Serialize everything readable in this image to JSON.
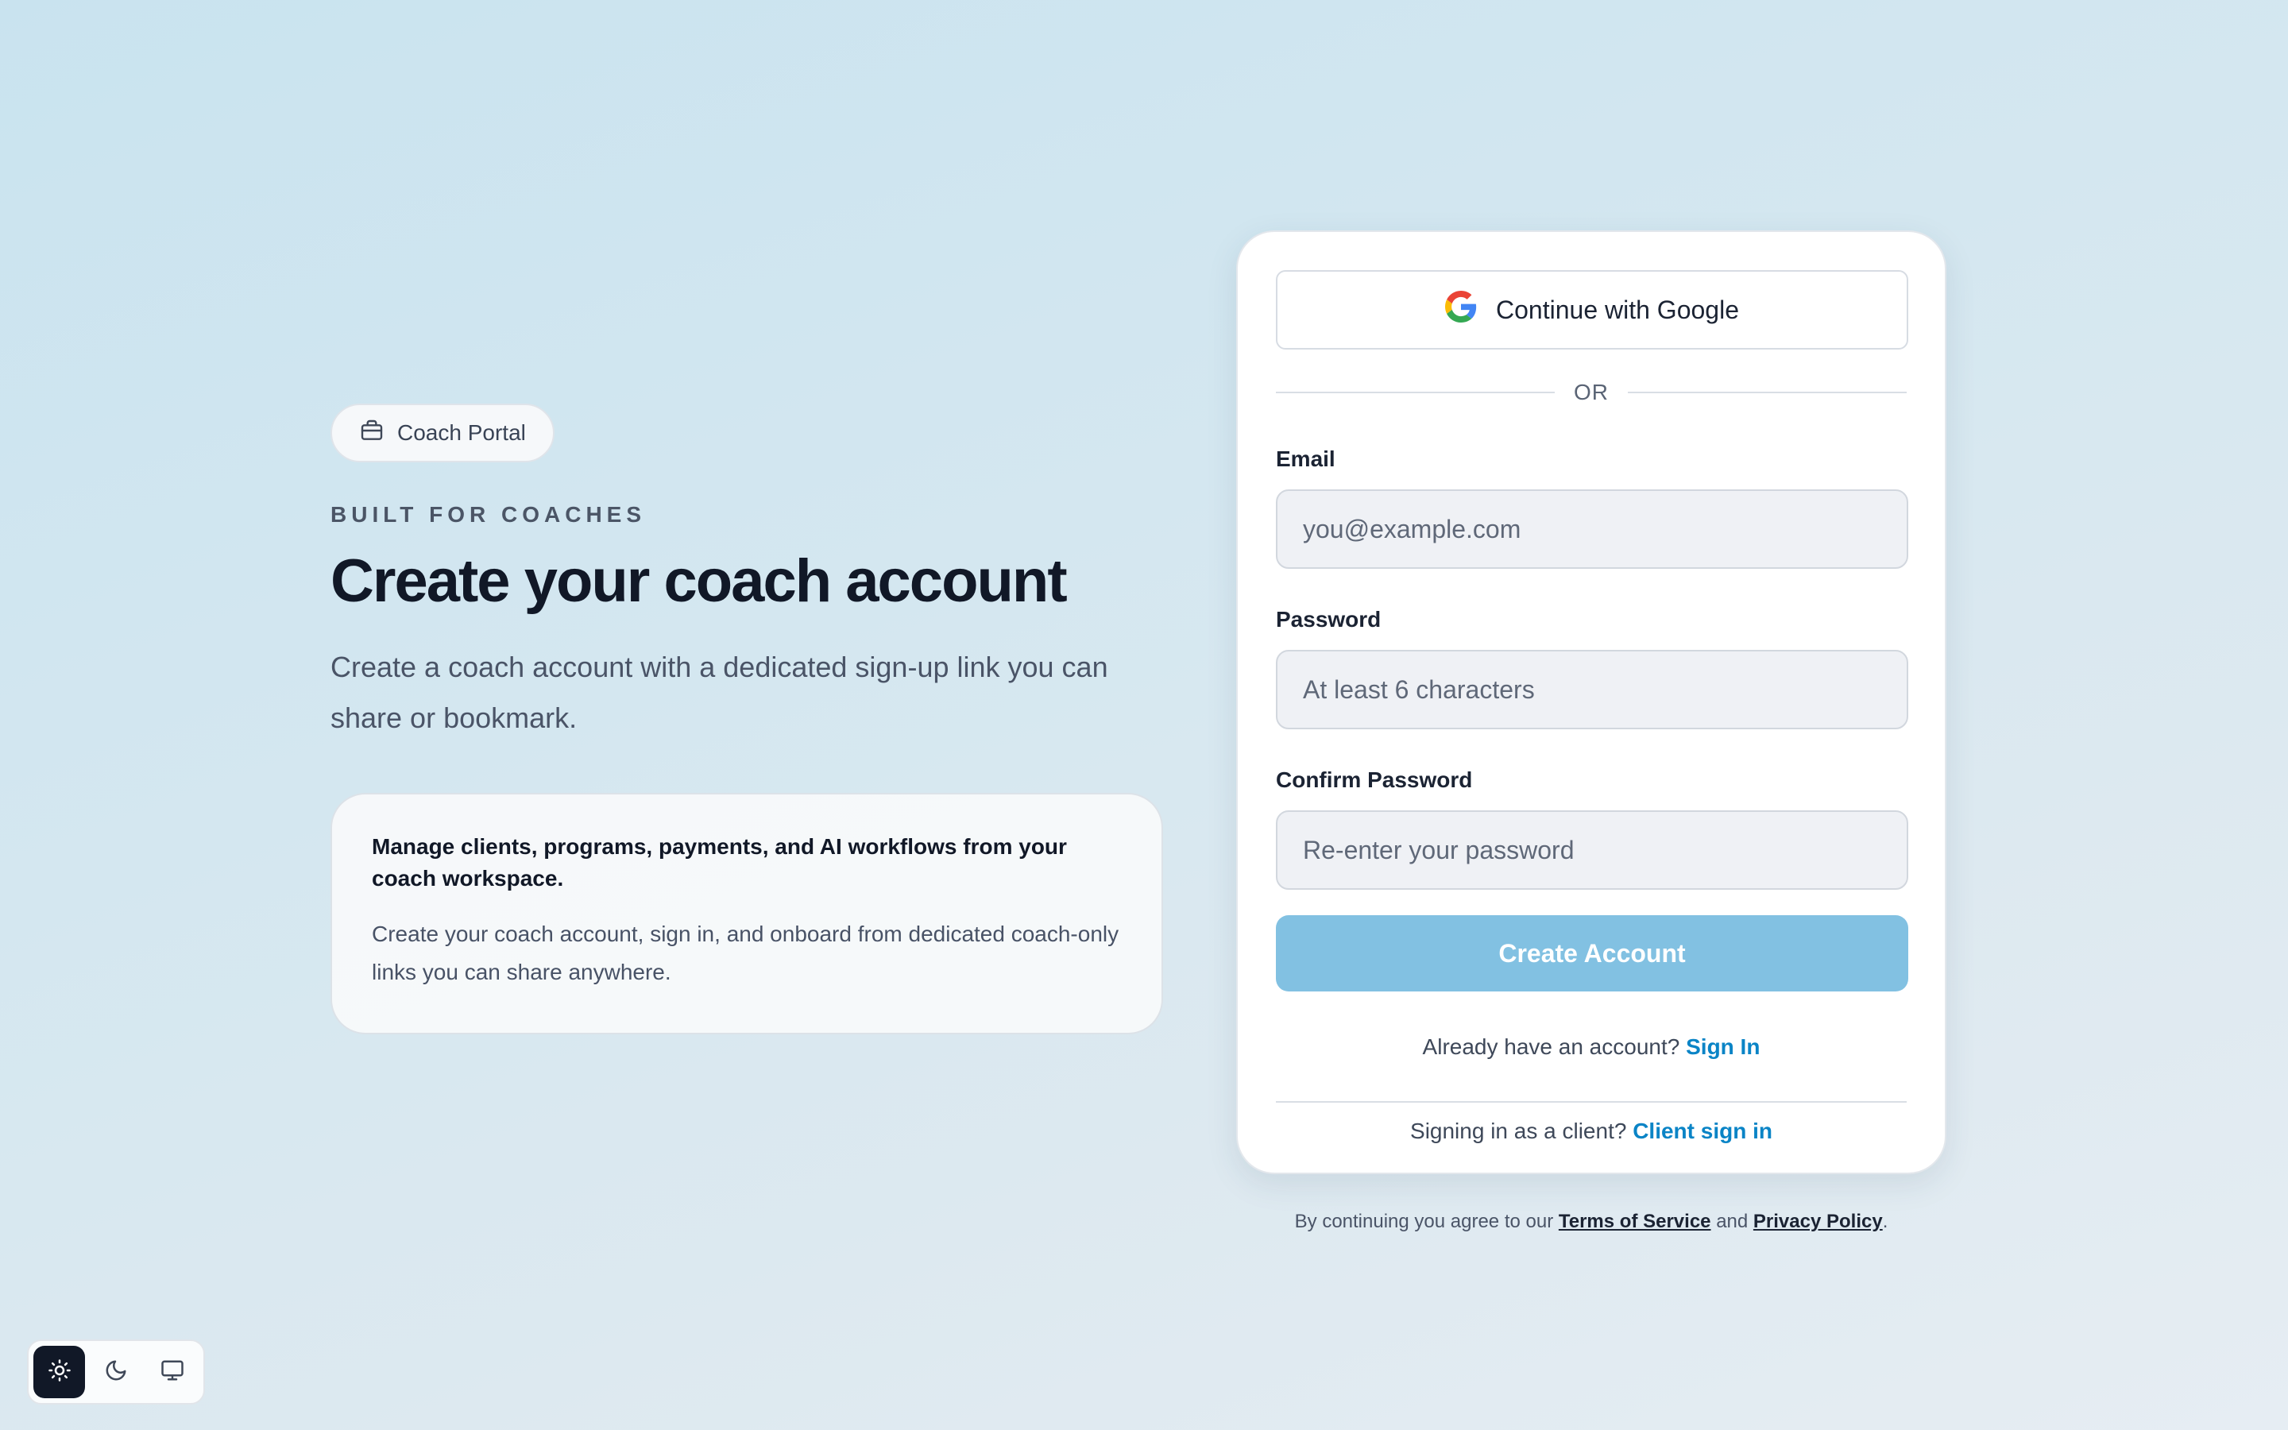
{
  "hero": {
    "badge_label": "Coach Portal",
    "badge_icon": "briefcase-icon",
    "eyebrow": "BUILT FOR COACHES",
    "title": "Create your coach account",
    "description": "Create a coach account with a dedicated sign-up link you can share or bookmark.",
    "feature": {
      "title": "Manage clients, programs, payments, and AI workflows from your coach workspace.",
      "body": "Create your coach account, sign in, and onboard from dedicated coach-only links you can share anywhere."
    }
  },
  "auth": {
    "google_label": "Continue with Google",
    "divider_text": "OR",
    "email_label": "Email",
    "email_placeholder": "you@example.com",
    "email_value": "",
    "password_label": "Password",
    "password_placeholder": "At least 6 characters",
    "password_value": "",
    "confirm_label": "Confirm Password",
    "confirm_placeholder": "Re-enter your password",
    "confirm_value": "",
    "submit_label": "Create Account",
    "signin_prompt": "Already have an account?",
    "signin_link": "Sign In",
    "client_prompt": "Signing in as a client?",
    "client_link": "Client sign in"
  },
  "legal": {
    "prefix": "By continuing you agree to our",
    "terms": "Terms of Service",
    "conjunction": "and",
    "privacy": "Privacy Policy",
    "suffix": "."
  },
  "theme": {
    "options": [
      "light",
      "dark",
      "system"
    ],
    "selected": "light",
    "icons": [
      "sun-icon",
      "moon-icon",
      "monitor-icon"
    ]
  },
  "colors": {
    "accent": "#0a84c6",
    "primary_button_disabled": "#82c1e2",
    "heading": "#111827"
  }
}
